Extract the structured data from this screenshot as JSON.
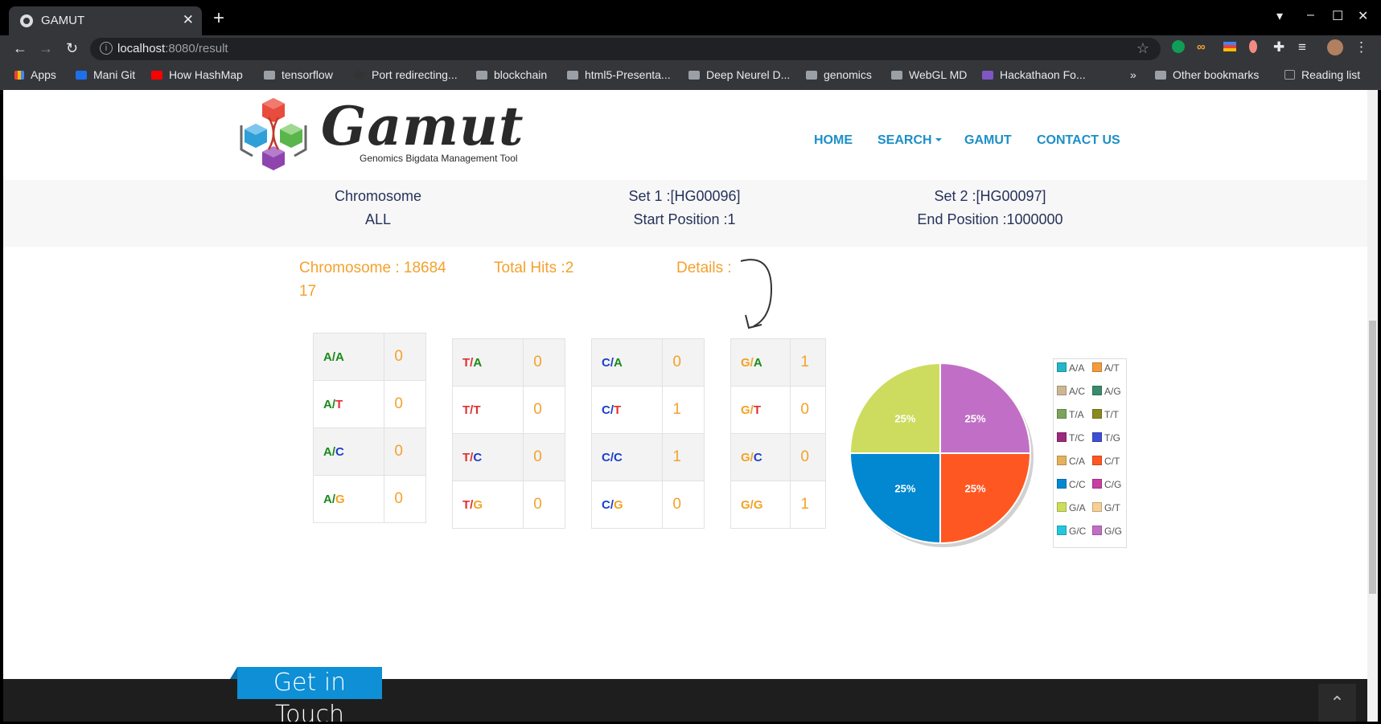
{
  "browser": {
    "tab_title": "GAMUT",
    "tab_close": "✕",
    "new_tab": "+",
    "url_host": "localhost",
    "url_path": ":8080/result",
    "bookmarks": [
      "Apps",
      "Mani Git",
      "How HashMap",
      "tensorflow",
      "Port redirecting...",
      "blockchain",
      "html5-Presenta...",
      "Deep Neurel D...",
      "genomics",
      "WebGL MD",
      "Hackathaon Fo..."
    ],
    "bookmarks_more": "»",
    "other_bookmarks": "Other bookmarks",
    "reading_list": "Reading list"
  },
  "site": {
    "brand": "Gamut",
    "tagline": "Genomics Bigdata Management Tool",
    "nav": {
      "home": "HOME",
      "search": "SEARCH",
      "gamut": "GAMUT",
      "contact": "CONTACT US"
    }
  },
  "query": {
    "chromosome_label": "Chromosome",
    "chromosome_value": "ALL",
    "set1": "Set 1 :[HG00096]",
    "start": "Start Position :1",
    "set2": "Set 2 :[HG00097]",
    "end": "End Position :1000000"
  },
  "result": {
    "chromosome_line1": "Chromosome : 18684",
    "chromosome_line2": "17",
    "total_hits": "Total Hits :2",
    "details": "Details :"
  },
  "tables": [
    [
      {
        "a": "A",
        "b": "A",
        "v": "0"
      },
      {
        "a": "A",
        "b": "T",
        "v": "0"
      },
      {
        "a": "A",
        "b": "C",
        "v": "0"
      },
      {
        "a": "A",
        "b": "G",
        "v": "0"
      }
    ],
    [
      {
        "a": "T",
        "b": "A",
        "v": "0"
      },
      {
        "a": "T",
        "b": "T",
        "v": "0"
      },
      {
        "a": "T",
        "b": "C",
        "v": "0"
      },
      {
        "a": "T",
        "b": "G",
        "v": "0"
      }
    ],
    [
      {
        "a": "C",
        "b": "A",
        "v": "0"
      },
      {
        "a": "C",
        "b": "T",
        "v": "1"
      },
      {
        "a": "C",
        "b": "C",
        "v": "1"
      },
      {
        "a": "C",
        "b": "G",
        "v": "0"
      }
    ],
    [
      {
        "a": "G",
        "b": "A",
        "v": "1"
      },
      {
        "a": "G",
        "b": "T",
        "v": "0"
      },
      {
        "a": "G",
        "b": "C",
        "v": "0"
      },
      {
        "a": "G",
        "b": "G",
        "v": "1"
      }
    ]
  ],
  "chart_data": {
    "type": "pie",
    "slices": [
      {
        "label": "25%",
        "value": 25,
        "color": "#c16fc6"
      },
      {
        "label": "25%",
        "value": 25,
        "color": "#ff5722"
      },
      {
        "label": "25%",
        "value": 25,
        "color": "#0288d1"
      },
      {
        "label": "25%",
        "value": 25,
        "color": "#cddc5f"
      }
    ],
    "legend": [
      {
        "label": "A/A",
        "color": "#26b5c8"
      },
      {
        "label": "A/T",
        "color": "#f39c3c"
      },
      {
        "label": "A/C",
        "color": "#cdb793"
      },
      {
        "label": "A/G",
        "color": "#3a8a6c"
      },
      {
        "label": "T/A",
        "color": "#7ca35a"
      },
      {
        "label": "T/T",
        "color": "#8a8a1e"
      },
      {
        "label": "T/C",
        "color": "#9c2a7c"
      },
      {
        "label": "T/G",
        "color": "#3e4fd6"
      },
      {
        "label": "C/A",
        "color": "#e4b15c"
      },
      {
        "label": "C/T",
        "color": "#ff5722"
      },
      {
        "label": "C/C",
        "color": "#0288d1"
      },
      {
        "label": "C/G",
        "color": "#c83ea3"
      },
      {
        "label": "G/A",
        "color": "#cddc5f"
      },
      {
        "label": "G/T",
        "color": "#f7cf95"
      },
      {
        "label": "G/C",
        "color": "#26c6da"
      },
      {
        "label": "G/G",
        "color": "#c16fc6"
      }
    ],
    "legend_position": "right"
  },
  "footer": {
    "get_in_touch": "Get in Touch",
    "to_top": "⌃"
  }
}
